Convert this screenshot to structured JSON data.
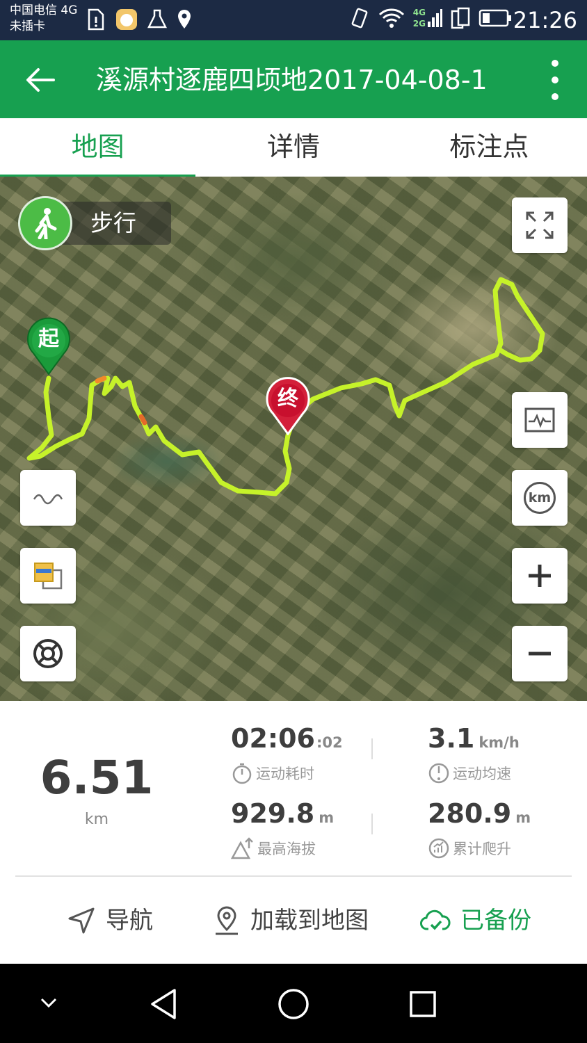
{
  "status_bar": {
    "carrier_line1": "中国电信 4G",
    "carrier_line2": "未插卡",
    "network_top": "4G",
    "network_bottom": "2G",
    "time": "21:26"
  },
  "app_bar": {
    "title": "溪源村逐鹿四顷地2017-04-08-1"
  },
  "tabs": [
    {
      "label": "地图",
      "active": true
    },
    {
      "label": "详情",
      "active": false
    },
    {
      "label": "标注点",
      "active": false
    }
  ],
  "map": {
    "mode_label": "步行",
    "start_marker": "起",
    "end_marker": "终",
    "km_label": "km",
    "route_color": "#c6f22a"
  },
  "stats": {
    "distance_value": "6.51",
    "distance_unit": "km",
    "duration_value": "02:06",
    "duration_seconds": ":02",
    "duration_label": "运动耗时",
    "speed_value": "3.1",
    "speed_unit": "km/h",
    "speed_label": "运动均速",
    "altitude_value": "929.8",
    "altitude_unit": "m",
    "altitude_label": "最高海拔",
    "climb_value": "280.9",
    "climb_unit": "m",
    "climb_label": "累计爬升"
  },
  "actions": {
    "navigate": "导航",
    "load_to_map": "加载到地图",
    "backed_up": "已备份"
  },
  "colors": {
    "brand_green": "#17a050",
    "status_bar": "#1c2a44"
  }
}
